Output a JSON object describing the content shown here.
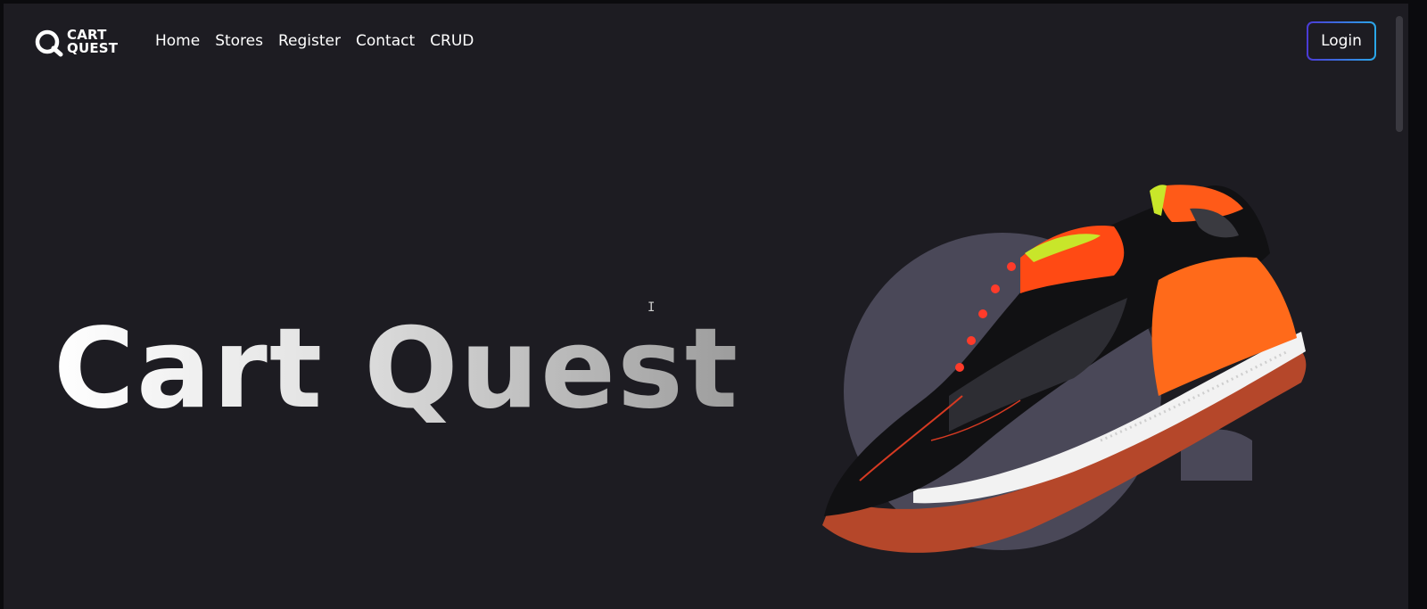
{
  "brand": {
    "line1": "CART",
    "line2": "QUEST"
  },
  "nav": {
    "items": [
      "Home",
      "Stores",
      "Register",
      "Contact",
      "CRUD"
    ]
  },
  "login_label": "Login",
  "hero": {
    "title": "Cart Quest"
  },
  "icons": {
    "logo": "magnifier-q-icon",
    "cursor": "text-cursor-icon"
  },
  "colors": {
    "background": "#1d1c22",
    "login_gradient_start": "#4b3ad6",
    "login_gradient_end": "#2aa8e8",
    "shoe_accent": "#ff5a1a"
  }
}
